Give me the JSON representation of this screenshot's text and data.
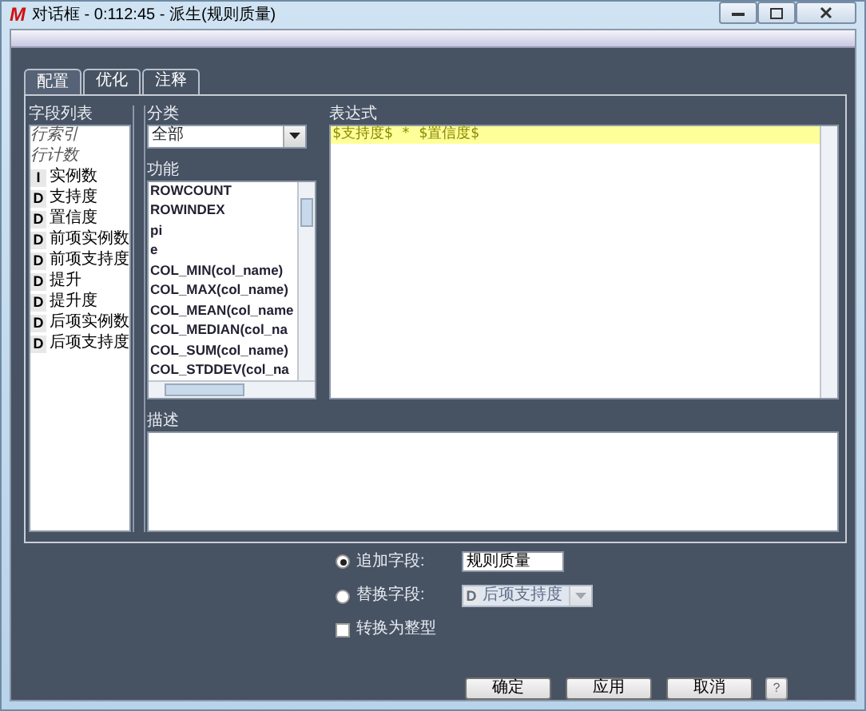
{
  "window": {
    "logo": "M",
    "title": "对话框 - 0:112:45 - 派生(规则质量)"
  },
  "tabs": [
    {
      "label": "配置",
      "selected": true
    },
    {
      "label": "优化",
      "selected": false
    },
    {
      "label": "注释",
      "selected": false
    }
  ],
  "field_list": {
    "title": "字段列表",
    "items": [
      {
        "kind": "meta",
        "label": "行索引"
      },
      {
        "kind": "meta",
        "label": "行计数"
      },
      {
        "kind": "field",
        "type": "I",
        "label": "实例数"
      },
      {
        "kind": "field",
        "type": "D",
        "label": "支持度"
      },
      {
        "kind": "field",
        "type": "D",
        "label": "置信度"
      },
      {
        "kind": "field",
        "type": "D",
        "label": "前项实例数"
      },
      {
        "kind": "field",
        "type": "D",
        "label": "前项支持度"
      },
      {
        "kind": "field",
        "type": "D",
        "label": "提升"
      },
      {
        "kind": "field",
        "type": "D",
        "label": "提升度"
      },
      {
        "kind": "field",
        "type": "D",
        "label": "后项实例数"
      },
      {
        "kind": "field",
        "type": "D",
        "label": "后项支持度"
      }
    ]
  },
  "category": {
    "label": "分类",
    "value": "全部"
  },
  "functions": {
    "label": "功能",
    "items": [
      "ROWCOUNT",
      "ROWINDEX",
      "pi",
      "e",
      "COL_MIN(col_name)",
      "COL_MAX(col_name)",
      "COL_MEAN(col_name",
      "COL_MEDIAN(col_na",
      "COL_SUM(col_name)",
      "COL_STDDEV(col_na"
    ]
  },
  "expression": {
    "label": "表达式",
    "value": "$支持度$ * $置信度$"
  },
  "description": {
    "label": "描述"
  },
  "options": [
    {
      "kind": "text",
      "label": "追加字段:",
      "selected": true,
      "value": "规则质量"
    },
    {
      "kind": "combo",
      "label": "替换字段:",
      "selected": false,
      "type": "D",
      "value": "后项支持度"
    }
  ],
  "convert": {
    "label": "转换为整型",
    "checked": false
  },
  "buttons": [
    "确定",
    "应用",
    "取消"
  ],
  "help": "?"
}
